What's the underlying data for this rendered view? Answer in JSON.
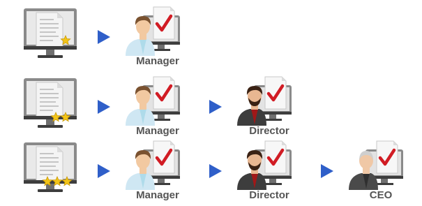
{
  "colors": {
    "arrow": "#2f5fc9",
    "check": "#d11c24",
    "star": "#f2c418",
    "monitor_frame": "#8a8a8a",
    "monitor_bezel": "#3d3d3d",
    "document": "#f4f4f4",
    "label_text": "#555555"
  },
  "rows": [
    {
      "stars": 1,
      "steps": [
        {
          "role": "manager",
          "label": "Manager"
        }
      ]
    },
    {
      "stars": 2,
      "steps": [
        {
          "role": "manager",
          "label": "Manager"
        },
        {
          "role": "director",
          "label": "Director"
        }
      ]
    },
    {
      "stars": 3,
      "steps": [
        {
          "role": "manager",
          "label": "Manager"
        },
        {
          "role": "director",
          "label": "Director"
        },
        {
          "role": "ceo",
          "label": "CEO"
        }
      ]
    }
  ]
}
